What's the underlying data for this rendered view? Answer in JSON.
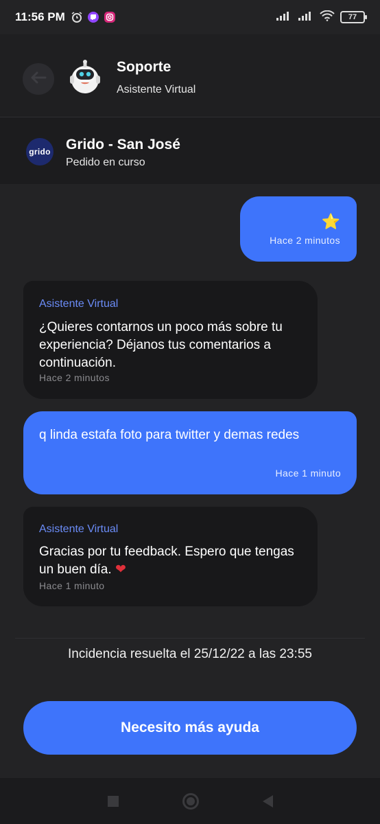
{
  "status_bar": {
    "time": "11:56 PM",
    "battery": "77",
    "icons": [
      "alarm-icon",
      "twitch-icon",
      "instagram-icon",
      "signal-icon",
      "signal-icon",
      "wifi-icon",
      "battery-icon"
    ]
  },
  "header": {
    "title": "Soporte",
    "subtitle": "Asistente Virtual"
  },
  "store": {
    "logo_text": "grido",
    "name": "Grido - San José",
    "status": "Pedido en curso"
  },
  "messages": [
    {
      "from": "user",
      "content": "⭐",
      "time": "Hace 2 minutos"
    },
    {
      "from": "bot",
      "sender": "Asistente Virtual",
      "content": "¿Quieres contarnos un poco más sobre tu experiencia? Déjanos tus comentarios a continuación.",
      "time": "Hace 2 minutos"
    },
    {
      "from": "user",
      "content": "q linda estafa foto para twitter y demas redes",
      "time": "Hace 1 minuto"
    },
    {
      "from": "bot",
      "sender": "Asistente Virtual",
      "content": "Gracias por tu feedback. Espero que tengas un buen día.",
      "emoji": "❤",
      "time": "Hace 1 minuto"
    }
  ],
  "resolution": "Incidencia resuelta el 25/12/22 a las 23:55",
  "help_button": "Necesito más ayuda",
  "colors": {
    "background": "#232325",
    "accent": "#3e74fb",
    "bot_bubble": "#18181a",
    "sender_label": "#6b8cf7"
  }
}
